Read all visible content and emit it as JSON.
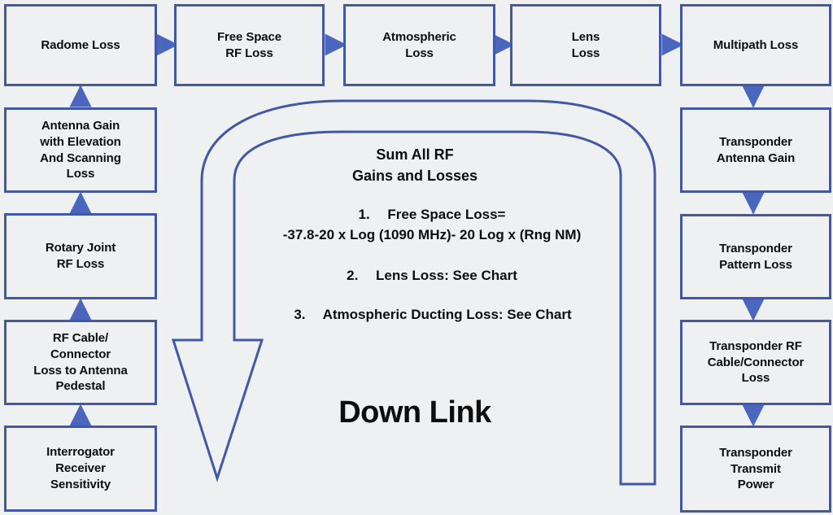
{
  "diagram": {
    "title_label": "Down Link",
    "background_color": "#eff0f2",
    "accent_color": "#4358a4",
    "text_color": "#0d0d0d",
    "top_row": [
      {
        "id": "radome-loss",
        "label": "Radome Loss"
      },
      {
        "id": "free-space-rf-loss",
        "label": "Free Space\nRF Loss"
      },
      {
        "id": "atmospheric-loss",
        "label": "Atmospheric\nLoss"
      },
      {
        "id": "lens-loss",
        "label": "Lens\nLoss"
      },
      {
        "id": "multipath-loss",
        "label": "Multipath Loss"
      }
    ],
    "left_column": [
      {
        "id": "antenna-gain",
        "label": "Antenna Gain\nwith Elevation\nAnd Scanning\nLoss"
      },
      {
        "id": "rotary-joint-rf-loss",
        "label": "Rotary Joint\nRF Loss"
      },
      {
        "id": "rf-cable-connector-loss",
        "label": "RF Cable/\nConnector\nLoss to Antenna\nPedestal"
      },
      {
        "id": "interrogator-receiver-sensitivity",
        "label": "Interrogator\nReceiver\nSensitivity"
      }
    ],
    "right_column": [
      {
        "id": "transponder-antenna-gain",
        "label": "Transponder\nAntenna Gain"
      },
      {
        "id": "transponder-pattern-loss",
        "label": "Transponder\nPattern Loss"
      },
      {
        "id": "transponder-rf-cable-connector-loss",
        "label": "Transponder RF\nCable/Connector\nLoss"
      },
      {
        "id": "transponder-transmit-power",
        "label": "Transponder\nTransmit\nPower"
      }
    ],
    "center_note": {
      "heading": "Sum All RF\nGains and Losses",
      "item_1": "1.  Free Space Loss=\n-37.8-20 x Log (1090 MHz)- 20 Log x (Rng NM)",
      "item_2": "2.  Lens Loss: See Chart",
      "item_3": "3.  Atmospheric Ducting Loss: See Chart"
    }
  }
}
